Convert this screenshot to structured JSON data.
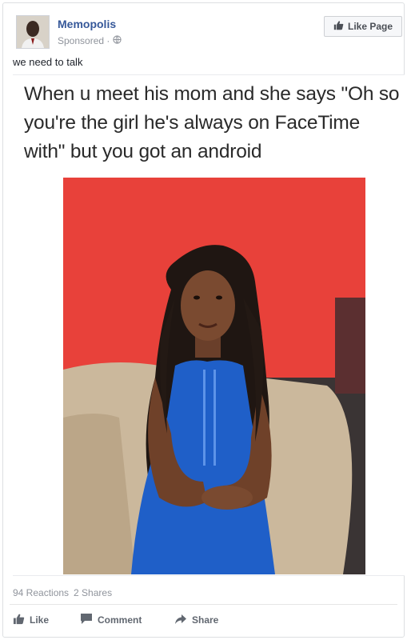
{
  "post": {
    "page_name": "Memopolis",
    "sponsored_label": "Sponsored ·",
    "like_page_label": "Like Page",
    "text": "we need to talk"
  },
  "meme": {
    "caption": "When u meet his mom and she says \"Oh so you're the girl he's always on FaceTime with\" but you got an android"
  },
  "stats": {
    "reactions": "94 Reactions",
    "shares": "2 Shares"
  },
  "actions": {
    "like": "Like",
    "comment": "Comment",
    "share": "Share"
  },
  "icons": {
    "like": "thumbs-up-icon",
    "comment": "speech-bubble-icon",
    "share": "share-arrow-icon",
    "globe": "globe-icon"
  },
  "colors": {
    "link_blue": "#365899",
    "meta_gray": "#90949c",
    "action_gray": "#616770",
    "photo_background_red": "#e53a36",
    "dress_blue": "#1f5fc8"
  }
}
